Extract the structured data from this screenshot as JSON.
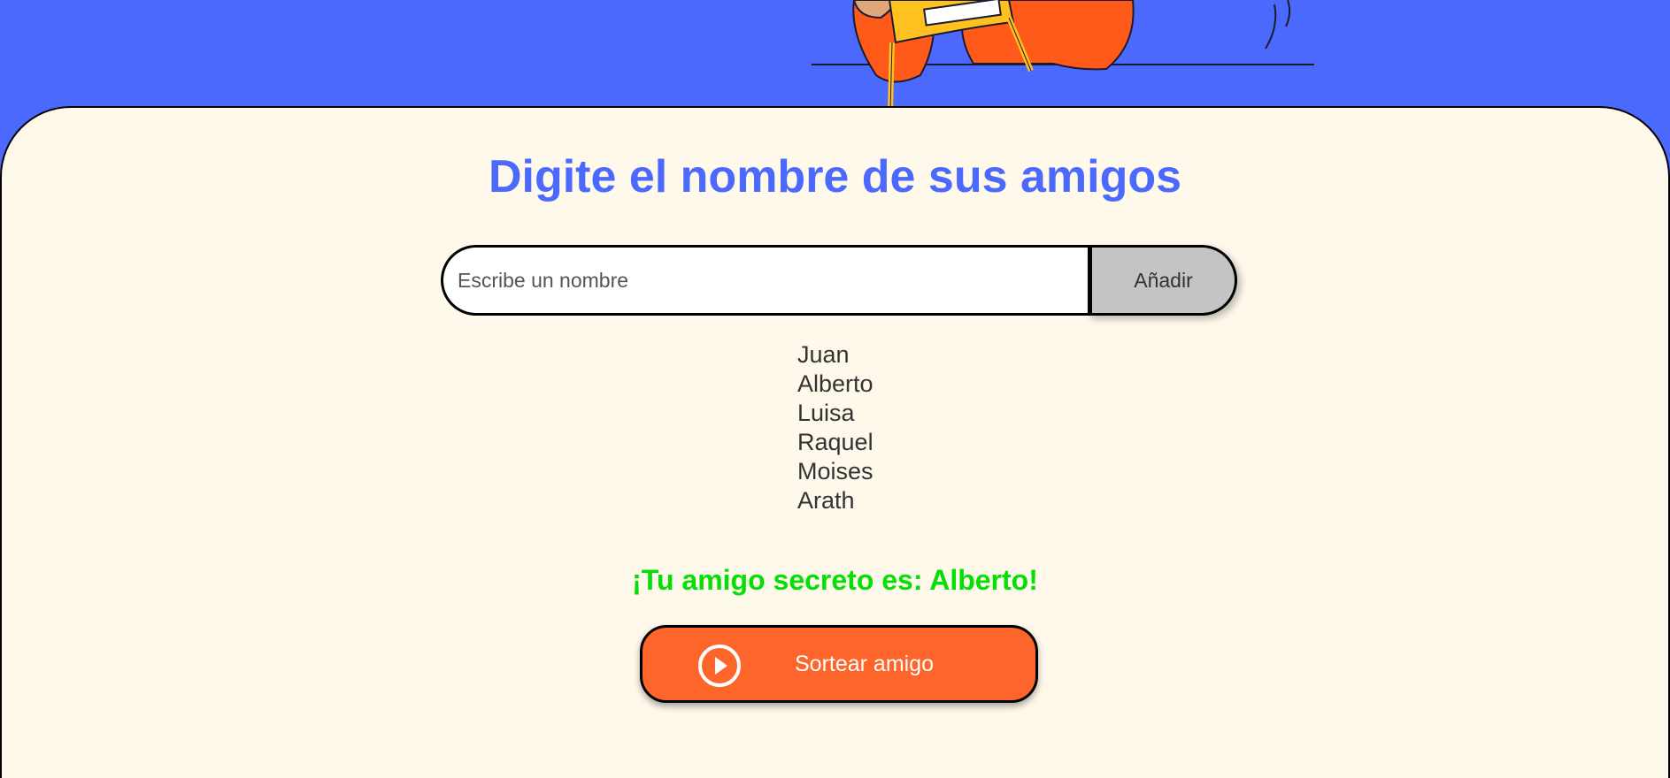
{
  "header": {
    "illustration_icon": "person-reading-illustration"
  },
  "main": {
    "title": "Digite el nombre de sus amigos",
    "input": {
      "placeholder": "Escribe un nombre",
      "value": ""
    },
    "add_button_label": "Añadir",
    "friends": [
      "Juan",
      "Alberto",
      "Luisa",
      "Raquel",
      "Moises",
      "Arath"
    ],
    "result_text": "¡Tu amigo secreto es: Alberto!",
    "draw_button": {
      "label": "Sortear amigo",
      "icon": "play-circle-icon"
    }
  },
  "colors": {
    "accent_blue": "#4b69fd",
    "panel_background": "#fff9eb",
    "button_orange": "#fe652b",
    "result_green": "#05df05",
    "add_button_gray": "#c4c4c4"
  }
}
